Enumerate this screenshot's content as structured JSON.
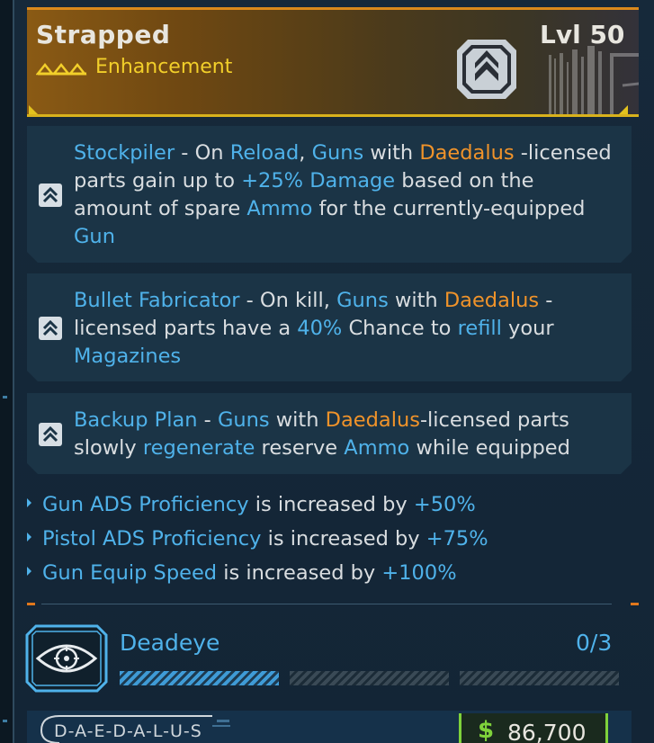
{
  "item": {
    "name": "Strapped",
    "type": "Enhancement",
    "level": "Lvl 50"
  },
  "perks": [
    {
      "name": "Stockpiler",
      "parts": [
        {
          "t": "Stockpiler",
          "c": "b"
        },
        {
          "t": " - On ",
          "c": ""
        },
        {
          "t": "Reload",
          "c": "b"
        },
        {
          "t": ", ",
          "c": ""
        },
        {
          "t": "Guns",
          "c": "b"
        },
        {
          "t": " with ",
          "c": ""
        },
        {
          "t": "Daedalus",
          "c": "o"
        },
        {
          "t": " -licensed parts gain up to ",
          "c": ""
        },
        {
          "t": "+25% Damage",
          "c": "b"
        },
        {
          "t": " based on the amount of spare ",
          "c": ""
        },
        {
          "t": "Ammo",
          "c": "b"
        },
        {
          "t": " for the currently-equipped ",
          "c": ""
        },
        {
          "t": "Gun",
          "c": "b"
        }
      ]
    },
    {
      "name": "Bullet Fabricator",
      "parts": [
        {
          "t": "Bullet Fabricator",
          "c": "b"
        },
        {
          "t": " - On kill, ",
          "c": ""
        },
        {
          "t": "Guns",
          "c": "b"
        },
        {
          "t": " with ",
          "c": ""
        },
        {
          "t": "Daedalus",
          "c": "o"
        },
        {
          "t": " -licensed parts have a ",
          "c": ""
        },
        {
          "t": "40%",
          "c": "b"
        },
        {
          "t": " Chance to ",
          "c": ""
        },
        {
          "t": "refill",
          "c": "b"
        },
        {
          "t": " your ",
          "c": ""
        },
        {
          "t": "Magazines",
          "c": "b"
        }
      ]
    },
    {
      "name": "Backup Plan",
      "parts": [
        {
          "t": "Backup Plan",
          "c": "b"
        },
        {
          "t": " - ",
          "c": ""
        },
        {
          "t": "Guns",
          "c": "b"
        },
        {
          "t": " with ",
          "c": ""
        },
        {
          "t": "Daedalus",
          "c": "o"
        },
        {
          "t": "-licensed parts slowly ",
          "c": ""
        },
        {
          "t": "regenerate",
          "c": "b"
        },
        {
          "t": " reserve ",
          "c": ""
        },
        {
          "t": "Ammo",
          "c": "b"
        },
        {
          "t": " while equipped",
          "c": ""
        }
      ]
    }
  ],
  "stats": [
    {
      "name": "Gun ADS Proficiency",
      "text": " is increased by ",
      "value": "+50%"
    },
    {
      "name": "Pistol ADS Proficiency",
      "text": " is increased by ",
      "value": "+75%"
    },
    {
      "name": "Gun Equip Speed",
      "text": " is increased by ",
      "value": "+100%"
    }
  ],
  "skill": {
    "name": "Deadeye",
    "rank": "0/3",
    "filled_segments": 1,
    "total_segments": 3,
    "icon": "eye-crosshair-icon"
  },
  "manufacturer": {
    "name": "D-A-E-D-A-L-U-S"
  },
  "price": {
    "symbol": "$",
    "value": "86,700"
  },
  "colors": {
    "accent_blue": "#4fb2ea",
    "accent_orange": "#f0932a",
    "enhancement_yellow": "#f2cf2a",
    "price_green": "#7fd23b"
  }
}
